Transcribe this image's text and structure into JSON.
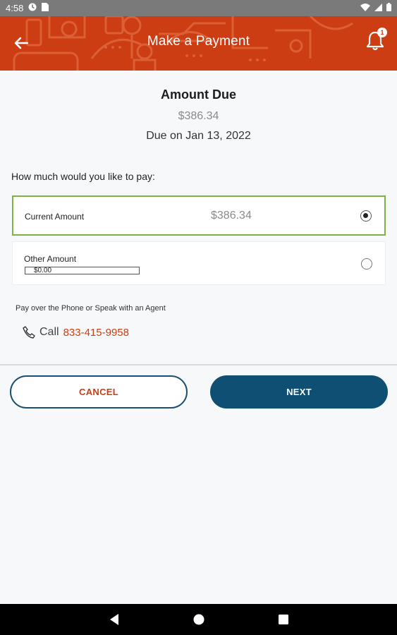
{
  "status_bar": {
    "time": "4:58",
    "icons": [
      "data-saver-icon",
      "sim-icon",
      "wifi-icon",
      "signal-icon",
      "battery-icon"
    ]
  },
  "app_bar": {
    "title": "Make a Payment",
    "back_icon": "arrow-left-icon",
    "bell_icon": "bell-icon",
    "notification_count": "1",
    "background_color": "#cc3d13"
  },
  "amount_due": {
    "heading": "Amount Due",
    "amount": "$386.34",
    "due_date": "Due on Jan 13, 2022"
  },
  "payment_question": "How much would you like to pay:",
  "options": {
    "current": {
      "label": "Current Amount",
      "value": "$386.34",
      "selected": true
    },
    "other": {
      "label": "Other Amount",
      "input_value": "$0.00",
      "selected": false
    }
  },
  "phone": {
    "label": "Pay over the Phone or Speak with an Agent",
    "call_word": "Call",
    "number": "833-415-9958",
    "icon": "phone-icon"
  },
  "buttons": {
    "cancel": "CANCEL",
    "next": "NEXT"
  },
  "colors": {
    "accent": "#cc3d13",
    "primary": "#0f4f73",
    "selected_border": "#7cb342"
  },
  "nav_bar": {
    "icons": [
      "back-triangle-icon",
      "home-circle-icon",
      "recents-square-icon"
    ]
  }
}
